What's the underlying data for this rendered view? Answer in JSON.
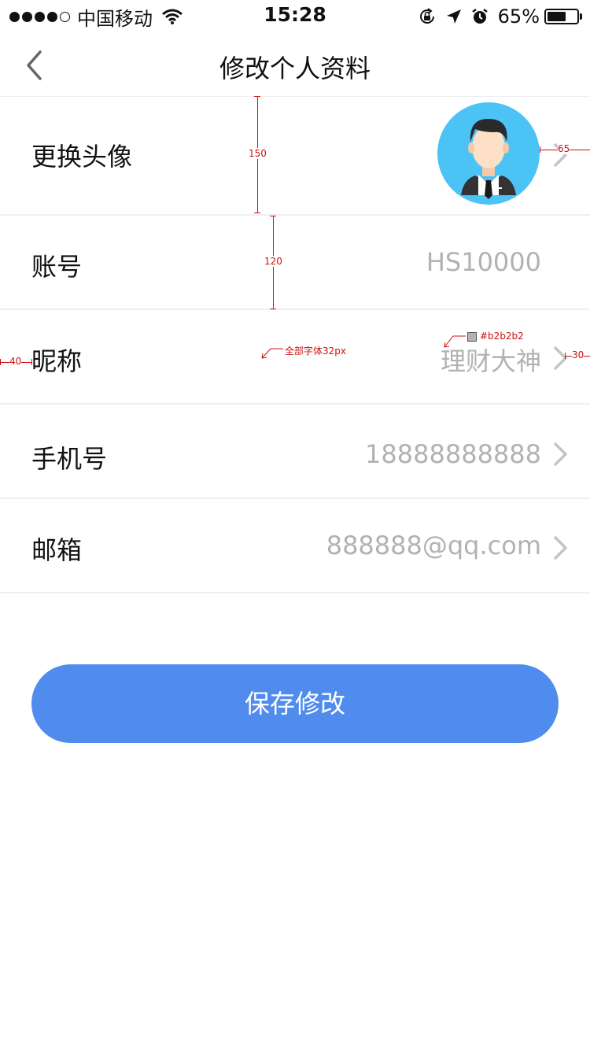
{
  "status_bar": {
    "carrier": "中国移动",
    "time": "15:28",
    "battery_percent": "65%",
    "battery_level": 0.65,
    "signal_bars_filled": 4,
    "signal_bars_total": 5
  },
  "nav": {
    "title": "修改个人资料",
    "back_icon": "chevron-left-icon"
  },
  "profile": {
    "avatar_label": "更换头像",
    "account_label": "账号",
    "account_value": "HS10000",
    "nickname_label": "昵称",
    "nickname_value": "理财大神",
    "phone_label": "手机号",
    "phone_value": "18888888888",
    "email_label": "邮箱",
    "email_value": "888888@qq.com"
  },
  "save_button": "保存修改",
  "annotations": {
    "avatar_row_height": "150",
    "row_height": "120",
    "avatar_right_margin": "65",
    "left_margin": "40",
    "right_margin": "30",
    "font_note": "全部字体32px",
    "color_note": "#b2b2b2"
  },
  "colors": {
    "accent": "#508cee",
    "value_text": "#b2b2b2",
    "avatar_bg": "#4cc3f5",
    "annotation": "#cc1111"
  }
}
